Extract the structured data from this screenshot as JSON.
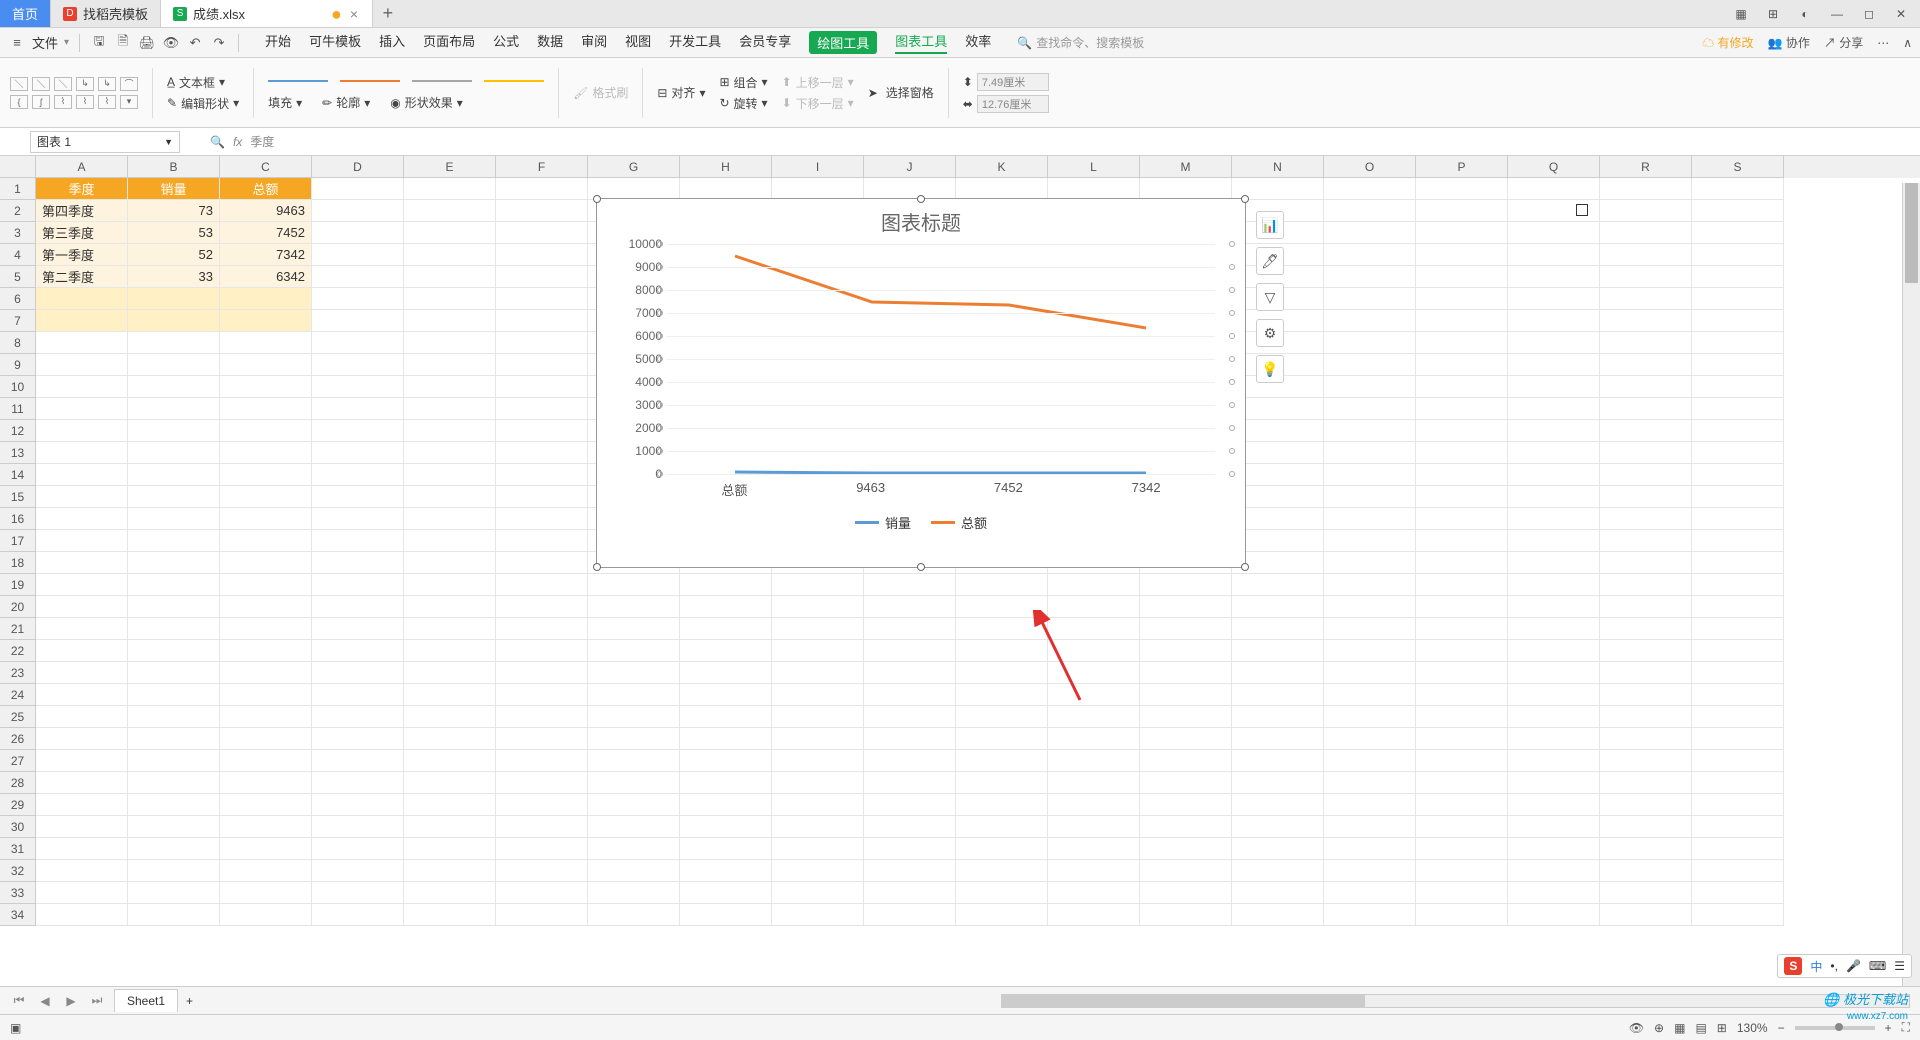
{
  "tabs": {
    "home": "首页",
    "tpl": "找稻壳模板",
    "file": "成绩.xlsx"
  },
  "menu": {
    "file": "文件",
    "items": [
      "开始",
      "可牛模板",
      "插入",
      "页面布局",
      "公式",
      "数据",
      "审阅",
      "视图",
      "开发工具",
      "会员专享"
    ],
    "draw": "绘图工具",
    "chart": "图表工具",
    "effect": "效率",
    "search_ph": "查找命令、搜索模板",
    "right": {
      "unsaved": "有修改",
      "coop": "协作",
      "share": "分享"
    }
  },
  "ribbon": {
    "textbox": "文本框",
    "editshape": "编辑形状",
    "fill": "填充",
    "outline": "轮廓",
    "effect": "形状效果",
    "fmtbrush": "格式刷",
    "align": "对齐",
    "group": "组合",
    "rotate": "旋转",
    "up": "上移一层",
    "down": "下移一层",
    "selpane": "选择窗格",
    "w": "7.49厘米",
    "h": "12.76厘米"
  },
  "formula": {
    "name": "图表 1",
    "fx": "季度"
  },
  "cols": [
    "A",
    "B",
    "C",
    "D",
    "E",
    "F",
    "G",
    "H",
    "I",
    "J",
    "K",
    "L",
    "M",
    "N",
    "O",
    "P",
    "Q",
    "R",
    "S"
  ],
  "rows_count": 34,
  "table": {
    "headers": [
      "季度",
      "销量",
      "总额"
    ],
    "rows": [
      [
        "第四季度",
        "73",
        "9463"
      ],
      [
        "第三季度",
        "53",
        "7452"
      ],
      [
        "第一季度",
        "52",
        "7342"
      ],
      [
        "第二季度",
        "33",
        "6342"
      ]
    ]
  },
  "chart": {
    "title": "图表标题",
    "x_labels": [
      "总额",
      "9463",
      "7452",
      "7342"
    ],
    "y_ticks": [
      "0",
      "1000",
      "2000",
      "3000",
      "4000",
      "5000",
      "6000",
      "7000",
      "8000",
      "9000",
      "10000"
    ],
    "legend": [
      "销量",
      "总额"
    ],
    "colors": {
      "s1": "#5b9bd5",
      "s2": "#ed7d31"
    }
  },
  "chart_data": {
    "type": "line",
    "title": "图表标题",
    "categories": [
      "总额",
      "9463",
      "7452",
      "7342"
    ],
    "series": [
      {
        "name": "销量",
        "values": [
          73,
          53,
          52,
          33
        ]
      },
      {
        "name": "总额",
        "values": [
          9463,
          7452,
          7342,
          6342
        ]
      }
    ],
    "ylim": [
      0,
      10000
    ],
    "ylabel": "",
    "xlabel": ""
  },
  "sheet_tab": "Sheet1",
  "status": {
    "zoom": "130%"
  },
  "ime": "中",
  "watermark": "极光下载站",
  "watermark_url": "www.xz7.com"
}
